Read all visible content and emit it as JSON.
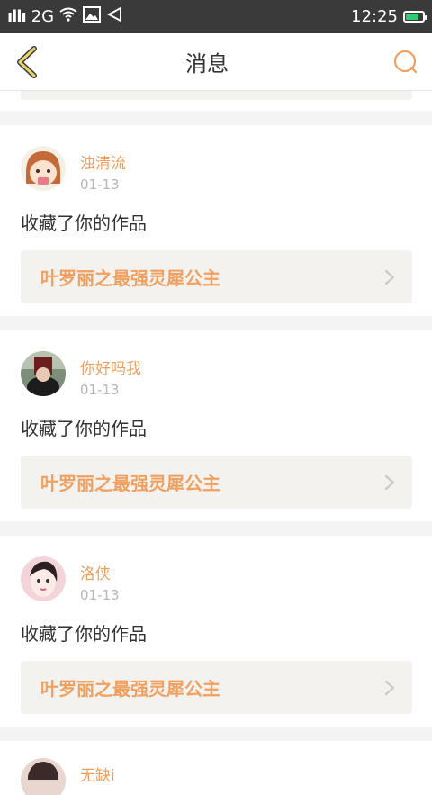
{
  "statusbar": {
    "signal": "ıllı",
    "network": "2G",
    "time": "12:25"
  },
  "navbar": {
    "title": "消息"
  },
  "notifications": [
    {
      "user": "浊清流",
      "date": "01-13",
      "action": "收藏了你的作品",
      "work_title": "叶罗丽之最强灵犀公主"
    },
    {
      "user": "你好吗我",
      "date": "01-13",
      "action": "收藏了你的作品",
      "work_title": "叶罗丽之最强灵犀公主"
    },
    {
      "user": "洛侠",
      "date": "01-13",
      "action": "收藏了你的作品",
      "work_title": "叶罗丽之最强灵犀公主"
    },
    {
      "user": "无缺i"
    }
  ],
  "colors": {
    "accent": "#f0a060",
    "status_bg": "#3a3a3a",
    "link_bg": "#f3f2ee"
  }
}
